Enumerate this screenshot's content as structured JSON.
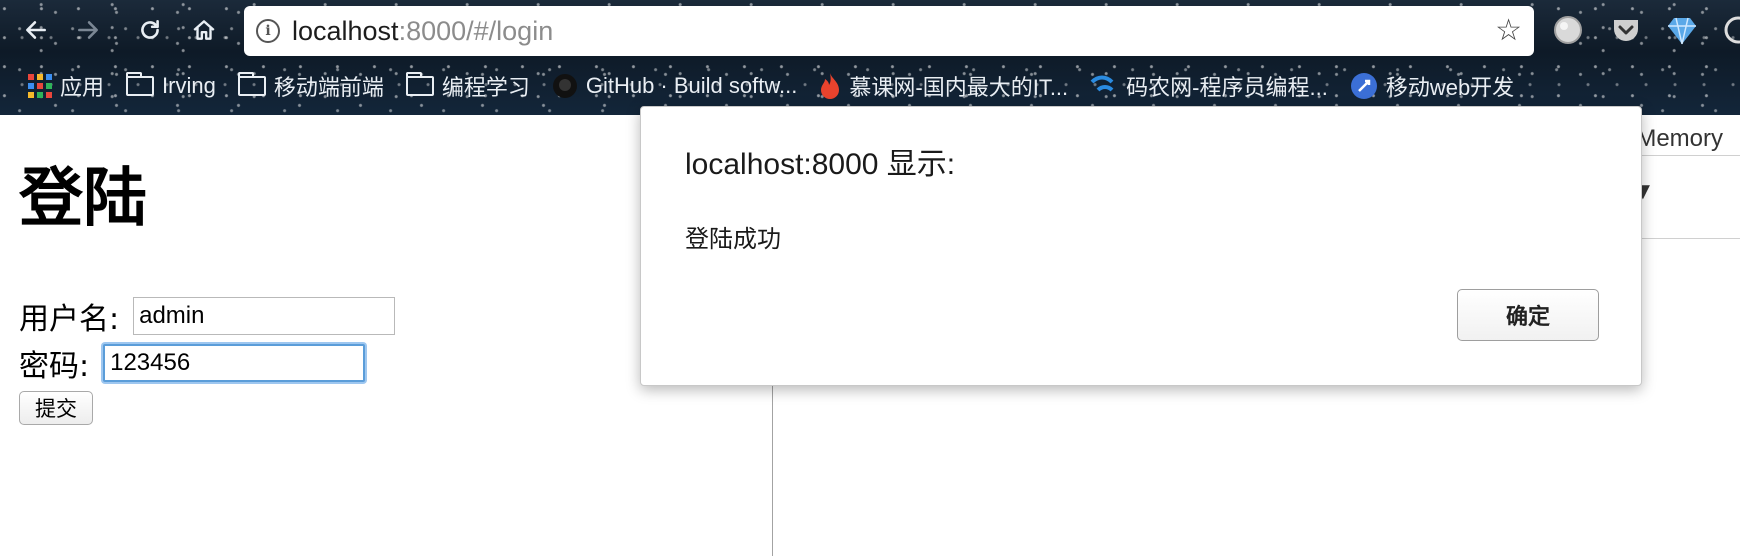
{
  "browser": {
    "url": {
      "host": "localhost",
      "path": ":8000/#/login"
    },
    "bookmarks": [
      {
        "label": "应用",
        "icon": "apps-grid-icon"
      },
      {
        "label": "Irving",
        "icon": "folder-icon"
      },
      {
        "label": "移动端前端",
        "icon": "folder-icon"
      },
      {
        "label": "编程学习",
        "icon": "folder-icon"
      },
      {
        "label": "GitHub · Build softw...",
        "icon": "github-icon"
      },
      {
        "label": "慕课网-国内最大的IT...",
        "icon": "flame-icon"
      },
      {
        "label": "码农网-程序员编程...",
        "icon": "wave-icon"
      },
      {
        "label": "移动web开发",
        "icon": "rocket-icon"
      }
    ]
  },
  "page": {
    "title": "登陆",
    "username_label": "用户名:",
    "username_value": "admin",
    "password_label": "密码:",
    "password_value": "123456",
    "submit_label": "提交"
  },
  "devtools": {
    "memory_tab": "Memory",
    "levels_label": "ls ▼"
  },
  "dialog": {
    "title": "localhost:8000 显示:",
    "message": "登陆成功",
    "ok_label": "确定"
  },
  "colors": {
    "focus_ring": "#5b9dd9",
    "chrome_bg": "#13263a"
  }
}
